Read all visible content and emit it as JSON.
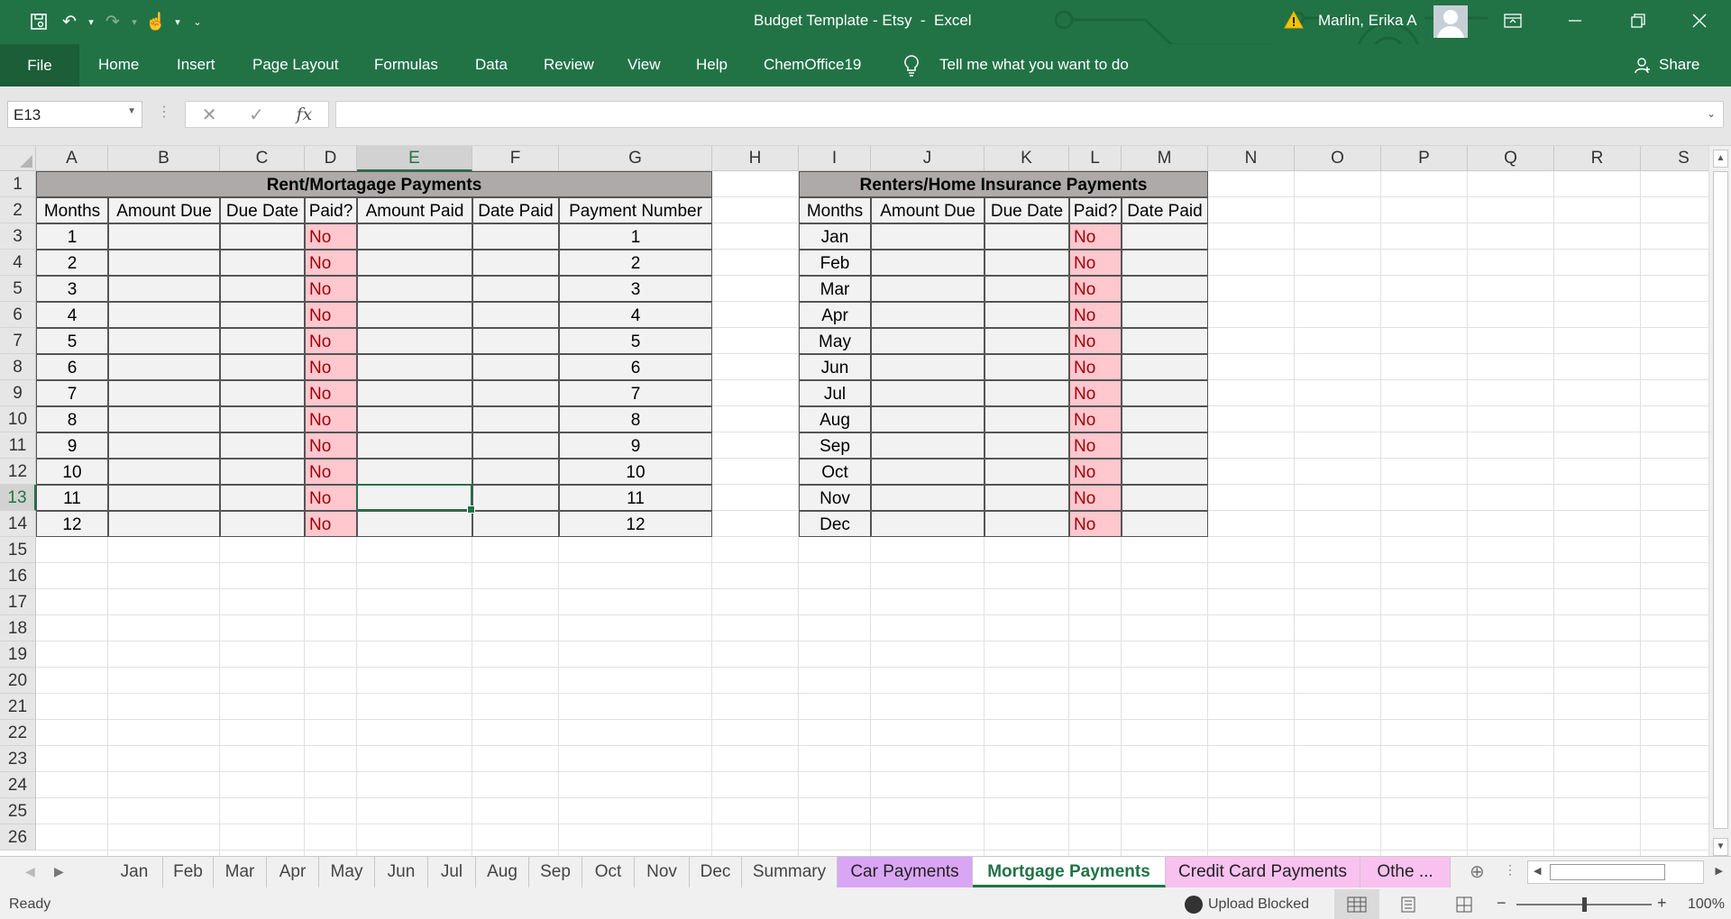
{
  "titlebar": {
    "title": "Budget Template - Etsy  -  Excel",
    "user": "Marlin, Erika A",
    "accent": "#217346"
  },
  "ribbon": {
    "file": "File",
    "tabs": [
      "Home",
      "Insert",
      "Page Layout",
      "Formulas",
      "Data",
      "Review",
      "View",
      "Help",
      "ChemOffice19"
    ],
    "tell_me": "Tell me what you want to do",
    "share": "Share"
  },
  "formula_bar": {
    "name_box": "E13",
    "fx": "fx",
    "formula": ""
  },
  "columns": [
    "A",
    "B",
    "C",
    "D",
    "E",
    "F",
    "G",
    "H",
    "I",
    "J",
    "K",
    "L",
    "M",
    "N",
    "O",
    "P",
    "Q",
    "R",
    "S"
  ],
  "rows": [
    "1",
    "2",
    "3",
    "4",
    "5",
    "6",
    "7",
    "8",
    "9",
    "10",
    "11",
    "12",
    "13",
    "14",
    "15",
    "16",
    "17",
    "18",
    "19",
    "20",
    "21",
    "22",
    "23",
    "24",
    "25",
    "26"
  ],
  "rent_table": {
    "title": "Rent/Mortagage Payments",
    "headers": [
      "Months",
      "Amount Due",
      "Due Date",
      "Paid?",
      "Amount Paid",
      "Date Paid",
      "Payment Number"
    ],
    "months": [
      "1",
      "2",
      "3",
      "4",
      "5",
      "6",
      "7",
      "8",
      "9",
      "10",
      "11",
      "12"
    ],
    "paid": [
      "No",
      "No",
      "No",
      "No",
      "No",
      "No",
      "No",
      "No",
      "No",
      "No",
      "No",
      "No"
    ],
    "payment_numbers": [
      "1",
      "2",
      "3",
      "4",
      "5",
      "6",
      "7",
      "8",
      "9",
      "10",
      "11",
      "12"
    ]
  },
  "insurance_table": {
    "title": "Renters/Home Insurance Payments",
    "headers": [
      "Months",
      "Amount Due",
      "Due Date",
      "Paid?",
      "Date Paid"
    ],
    "months": [
      "Jan",
      "Feb",
      "Mar",
      "Apr",
      "May",
      "Jun",
      "Jul",
      "Aug",
      "Sep",
      "Oct",
      "Nov",
      "Dec"
    ],
    "paid": [
      "No",
      "No",
      "No",
      "No",
      "No",
      "No",
      "No",
      "No",
      "No",
      "No",
      "No",
      "No"
    ]
  },
  "sheet_tabs": [
    "Jan",
    "Feb",
    "Mar",
    "Apr",
    "May",
    "Jun",
    "Jul",
    "Aug",
    "Sep",
    "Oct",
    "Nov",
    "Dec",
    "Summary",
    "Car Payments",
    "Mortgage Payments",
    "Credit Card Payments",
    "Othe ..."
  ],
  "active_sheet": "Mortgage Payments",
  "tab_colors": {
    "car": "#d9a6f5",
    "credit": "#f9c1ef",
    "other": "#f9c1ef"
  },
  "status": {
    "ready": "Ready",
    "upload": "Upload Blocked",
    "zoom": "100%"
  }
}
